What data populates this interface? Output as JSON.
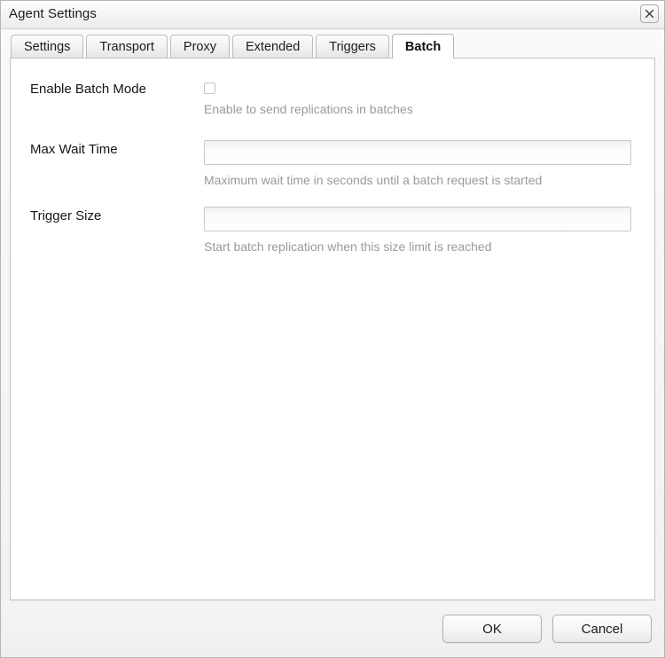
{
  "window": {
    "title": "Agent Settings",
    "close_icon": "close-icon"
  },
  "tabs": [
    {
      "label": "Settings",
      "active": false
    },
    {
      "label": "Transport",
      "active": false
    },
    {
      "label": "Proxy",
      "active": false
    },
    {
      "label": "Extended",
      "active": false
    },
    {
      "label": "Triggers",
      "active": false
    },
    {
      "label": "Batch",
      "active": true
    }
  ],
  "form": {
    "fields": [
      {
        "label": "Enable Batch Mode",
        "type": "checkbox",
        "checked": false,
        "hint": "Enable to send replications in batches"
      },
      {
        "label": "Max Wait Time",
        "type": "text",
        "value": "",
        "placeholder": "",
        "hint": "Maximum wait time in seconds until a batch request is started"
      },
      {
        "label": "Trigger Size",
        "type": "text",
        "value": "",
        "placeholder": "",
        "hint": "Start batch replication when this size limit is reached"
      }
    ]
  },
  "footer": {
    "ok_label": "OK",
    "cancel_label": "Cancel"
  }
}
